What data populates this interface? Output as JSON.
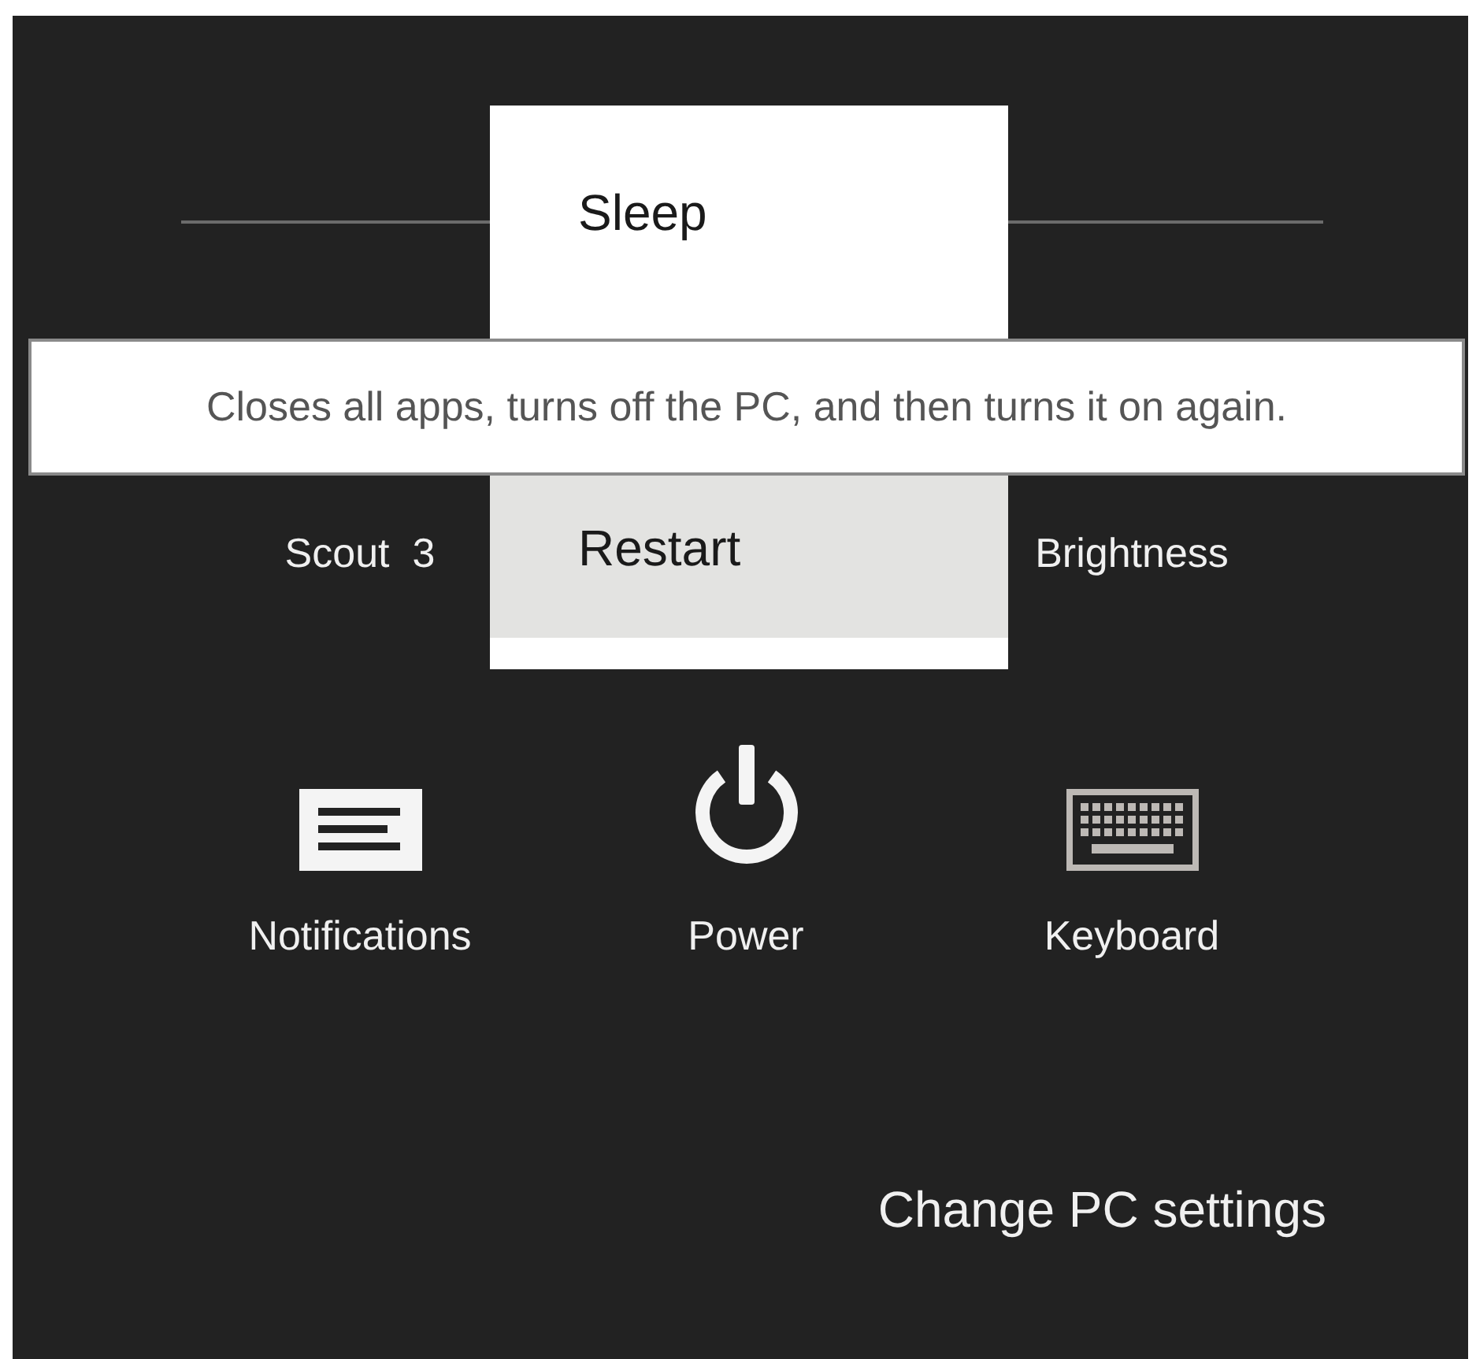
{
  "quick_settings": [
    {
      "label": "Scout  3"
    },
    {
      "label": "Brightness"
    }
  ],
  "power_menu": {
    "items": [
      {
        "label": "Sleep",
        "selected": false
      },
      {
        "label": "Restart",
        "selected": true
      }
    ]
  },
  "tooltip": {
    "text": "Closes all apps, turns off the PC, and then turns it on again."
  },
  "tiles": [
    {
      "kind": "notifications",
      "label": "Notifications"
    },
    {
      "kind": "power",
      "label": "Power"
    },
    {
      "kind": "keyboard",
      "label": "Keyboard"
    }
  ],
  "footer_link": "Change PC settings"
}
